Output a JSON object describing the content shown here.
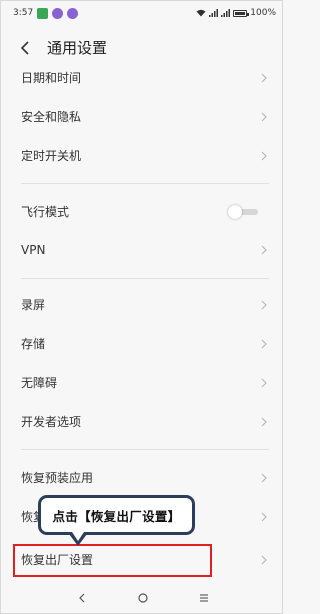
{
  "status_bar": {
    "time": "3:57",
    "battery_text": "100%",
    "battery_level": 1.0,
    "app_icons": [
      "green-app-icon",
      "purple-app-icon",
      "purple-app-icon"
    ]
  },
  "header": {
    "back_icon": "chevron-left-icon",
    "title": "通用设置"
  },
  "settings": {
    "date_time": "日期和时间",
    "security_privacy": "安全和隐私",
    "scheduled_power": "定时开关机",
    "airplane_mode": "飞行模式",
    "airplane_mode_on": false,
    "vpn": "VPN",
    "screen_record": "录屏",
    "storage": "存储",
    "accessibility": "无障碍",
    "developer_options": "开发者选项",
    "restore_preinstalled": "恢复预装应用",
    "backup_restore_partial": "恢复",
    "factory_reset": "恢复出厂设置"
  },
  "callout": {
    "text": "点击【恢复出厂设置】"
  },
  "colors": {
    "background": "#f7f7f7",
    "highlight_border": "#e32020",
    "callout_border": "#2b3f5c",
    "chevron": "#b5b5b5"
  },
  "nav_bar": {
    "icons": [
      "back-nav-icon",
      "home-nav-icon",
      "menu-nav-icon"
    ]
  }
}
